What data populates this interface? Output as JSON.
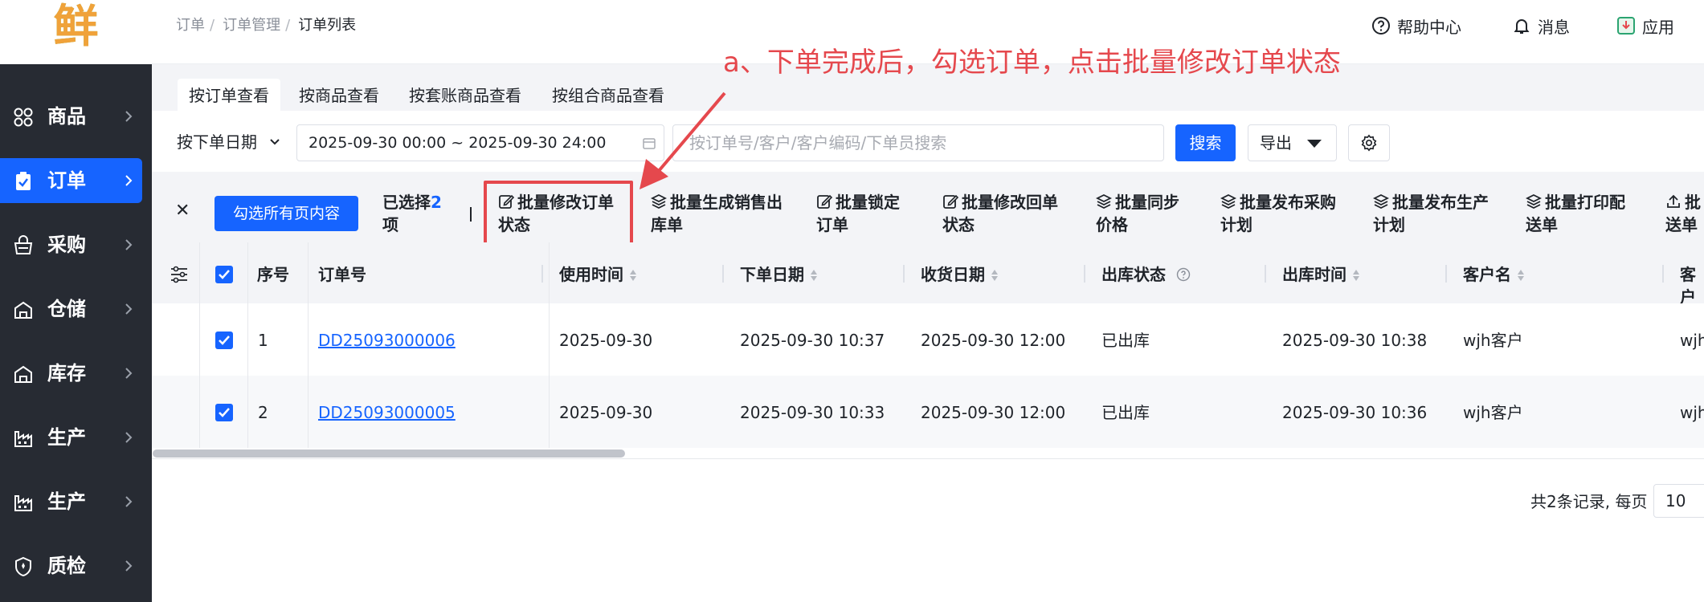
{
  "logo": {
    "char": "鲜"
  },
  "sidebar": {
    "items": [
      {
        "label": "商品",
        "icon": "grid-icon"
      },
      {
        "label": "订单",
        "icon": "clipboard-icon"
      },
      {
        "label": "采购",
        "icon": "basket-icon"
      },
      {
        "label": "仓储",
        "icon": "warehouse-icon"
      },
      {
        "label": "库存",
        "icon": "warehouse-icon"
      },
      {
        "label": "生产",
        "icon": "factory-icon"
      },
      {
        "label": "生产",
        "icon": "factory-icon"
      },
      {
        "label": "质检",
        "icon": "shield-icon"
      }
    ],
    "active_index": 1
  },
  "breadcrumb": {
    "items": [
      "订单",
      "订单管理",
      "订单列表"
    ]
  },
  "header": {
    "help": "帮助中心",
    "messages": "消息",
    "apps": "应用"
  },
  "tabs": [
    {
      "label": "按订单查看",
      "active": true
    },
    {
      "label": "按商品查看",
      "active": false
    },
    {
      "label": "按套账商品查看",
      "active": false
    },
    {
      "label": "按组合商品查看",
      "active": false
    }
  ],
  "filters": {
    "date_type": "按下单日期",
    "date_range": "2025-09-30 00:00 ~ 2025-09-30 24:00",
    "search_placeholder": "按订单号/客户/客户编码/下单员搜索",
    "search_button": "搜索",
    "export_button": "导出"
  },
  "batch": {
    "close": "✕",
    "select_all_pages": "勾选所有页内容",
    "selected_prefix": "已选择",
    "selected_count": "2",
    "selected_suffix": "项",
    "actions": [
      {
        "line1": "批量修改订单",
        "line2": "状态",
        "icon": "edit-icon"
      },
      {
        "line1": "批量生成销售出",
        "line2": "库单",
        "icon": "layers-icon"
      },
      {
        "line1": "批量锁定",
        "line2": "订单",
        "icon": "edit-icon"
      },
      {
        "line1": "批量修改回单",
        "line2": "状态",
        "icon": "edit-icon"
      },
      {
        "line1": "批量同步",
        "line2": "价格",
        "icon": "layers-icon"
      },
      {
        "line1": "批量发布采购",
        "line2": "计划",
        "icon": "layers-icon"
      },
      {
        "line1": "批量发布生产",
        "line2": "计划",
        "icon": "layers-icon"
      },
      {
        "line1": "批量打印配",
        "line2": "送单",
        "icon": "layers-icon"
      },
      {
        "line1": "批",
        "line2": "送单",
        "icon": "upload-icon"
      }
    ]
  },
  "annotation": {
    "text": "a、下单完成后，勾选订单，点击批量修改订单状态",
    "color": "#e5484d"
  },
  "table": {
    "columns": [
      "序号",
      "订单号",
      "使用时间",
      "下单日期",
      "收货日期",
      "出库状态",
      "出库时间",
      "客户名",
      "客户"
    ],
    "rows": [
      {
        "index": "1",
        "order_no": "DD25093000006",
        "use_date": "2025-09-30",
        "order_date": "2025-09-30 10:37",
        "receive_date": "2025-09-30 12:00",
        "status": "已出库",
        "out_time": "2025-09-30 10:38",
        "customer": "wjh客户",
        "customer2": "wjh"
      },
      {
        "index": "2",
        "order_no": "DD25093000005",
        "use_date": "2025-09-30",
        "order_date": "2025-09-30 10:33",
        "receive_date": "2025-09-30 12:00",
        "status": "已出库",
        "out_time": "2025-09-30 10:36",
        "customer": "wjh客户",
        "customer2": "wjh"
      }
    ]
  },
  "pagination": {
    "summary": "共2条记录, 每页",
    "page_size": "10"
  },
  "colors": {
    "primary": "#1664ff",
    "sidebar": "#272b33",
    "highlight": "#e5484d"
  }
}
